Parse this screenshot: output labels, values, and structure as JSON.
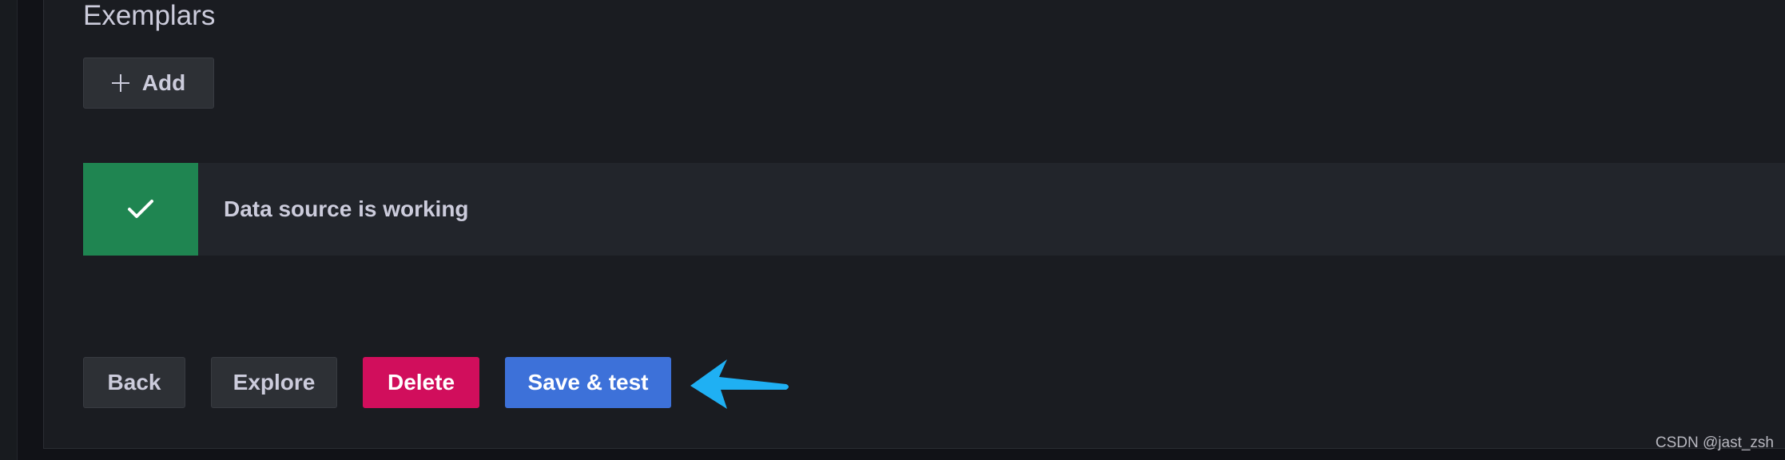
{
  "section": {
    "title": "Exemplars",
    "add_label": "Add"
  },
  "alert": {
    "message": "Data source is working",
    "status": "success",
    "status_color": "#1f8551"
  },
  "actions": {
    "back_label": "Back",
    "explore_label": "Explore",
    "delete_label": "Delete",
    "save_label": "Save & test"
  },
  "colors": {
    "delete": "#d10e5c",
    "primary": "#3d71d9",
    "annotation_arrow": "#1fb0f3"
  },
  "icons": {
    "add": "plus-icon",
    "alert": "check-icon",
    "annotation": "arrow-left-icon"
  },
  "watermark": "CSDN @jast_zsh"
}
